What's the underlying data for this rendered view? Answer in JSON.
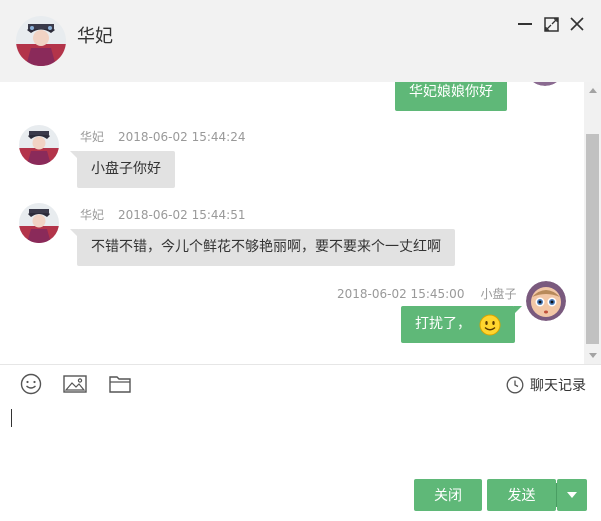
{
  "header": {
    "title": "华妃"
  },
  "window_controls": [
    "minimize-icon",
    "maximize-icon",
    "close-icon"
  ],
  "messages": [
    {
      "side": "right",
      "text": "华妃娘娘你好"
    },
    {
      "side": "left",
      "name": "华妃",
      "time": "2018-06-02 15:44:24",
      "text": "小盘子你好"
    },
    {
      "side": "left",
      "name": "华妃",
      "time": "2018-06-02 15:44:51",
      "text": "不错不错，今儿个鲜花不够艳丽啊，要不要来个一丈红啊"
    },
    {
      "side": "right",
      "name": "小盘子",
      "time": "2018-06-02 15:45:00",
      "text": "打扰了，",
      "emoji": "smiley-emoji"
    }
  ],
  "toolbar": {
    "icons": [
      "emoji-icon",
      "image-icon",
      "folder-icon"
    ],
    "history_label": "聊天记录"
  },
  "input": {
    "value": ""
  },
  "buttons": {
    "close": "关闭",
    "send": "发送"
  },
  "colors": {
    "accent": "#5fb878",
    "bubble_left": "#e2e2e2",
    "header_bg": "#f2f2f2"
  }
}
